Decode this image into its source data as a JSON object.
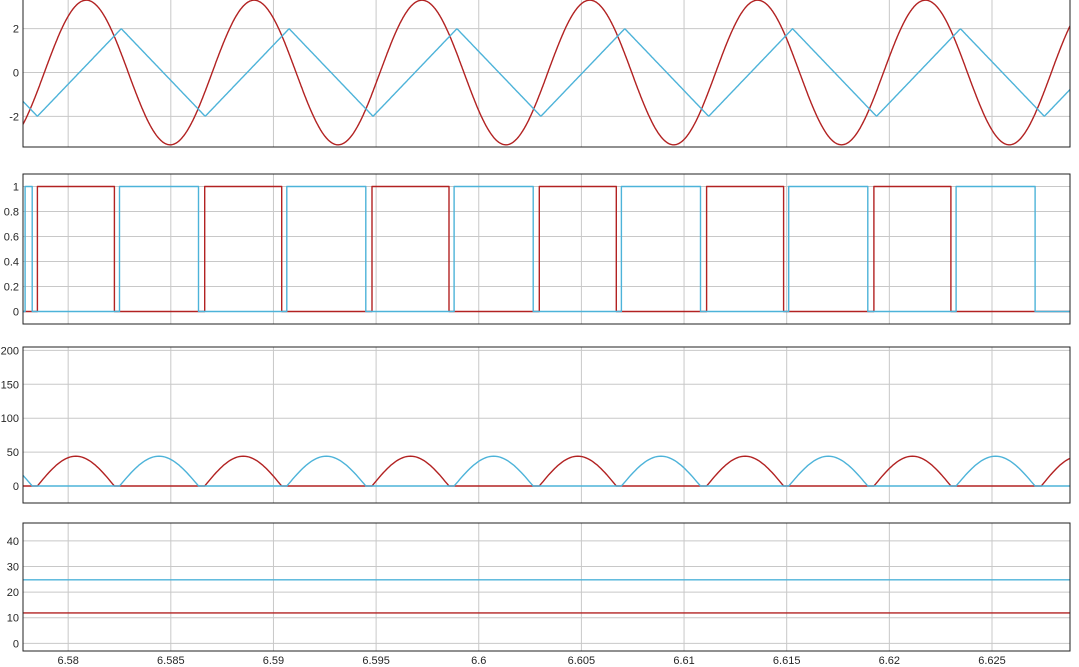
{
  "chart_data": [
    {
      "type": "line",
      "x_range": [
        6.5778,
        6.6288
      ],
      "xlim": [
        6.5778,
        6.6288
      ],
      "x_ticks": [],
      "ylim": [
        -3.4,
        3.4
      ],
      "y_ticks": [
        "-2",
        "0",
        "2"
      ],
      "y_tick_values": [
        -2,
        0,
        2
      ],
      "grid": true,
      "series": [
        {
          "color": "#b22222",
          "shape": "sine",
          "amplitude": 3.3,
          "period": 0.008175,
          "zero_up": 6.57884,
          "note_values": "peak 3.3, trough -3.3"
        },
        {
          "color": "#4db3d9",
          "shape": "triangle",
          "amplitude": 2.0,
          "period": 0.008175,
          "trough_at": 6.5785
        }
      ]
    },
    {
      "type": "line",
      "xlim": [
        6.5778,
        6.6288
      ],
      "ylim": [
        -0.1,
        1.1
      ],
      "y_ticks": [
        "0",
        "0.2",
        "0.4",
        "0.6",
        "0.8",
        "1"
      ],
      "y_tick_values": [
        0,
        0.2,
        0.4,
        0.6,
        0.8,
        1
      ],
      "grid": true,
      "series": [
        {
          "color": "#b22222",
          "shape": "square",
          "high_intervals": [
            [
              6.5785,
              6.58225
            ],
            [
              6.58665,
              6.5904
            ],
            [
              6.5948,
              6.59855
            ],
            [
              6.60295,
              6.6067
            ],
            [
              6.6111,
              6.61485
            ],
            [
              6.61925,
              6.623
            ]
          ]
        },
        {
          "color": "#4db3d9",
          "shape": "square",
          "high_intervals": [
            [
              6.5779,
              6.57825
            ],
            [
              6.5825,
              6.58635
            ],
            [
              6.59065,
              6.5945
            ],
            [
              6.5988,
              6.60265
            ],
            [
              6.60695,
              6.6108
            ],
            [
              6.6151,
              6.61895
            ],
            [
              6.62325,
              6.6271
            ]
          ]
        }
      ]
    },
    {
      "type": "line",
      "xlim": [
        6.5778,
        6.6288
      ],
      "ylim": [
        -25,
        205
      ],
      "y_ticks": [
        "0",
        "50",
        "100",
        "150",
        "200"
      ],
      "y_tick_values": [
        0,
        50,
        100,
        150,
        200
      ],
      "grid": true,
      "series": [
        {
          "color": "#b22222",
          "shape": "half-sine",
          "peak": 44,
          "arcs": [
            [
              6.5785,
              6.58225
            ],
            [
              6.58665,
              6.5904
            ],
            [
              6.5948,
              6.59855
            ],
            [
              6.60295,
              6.6067
            ],
            [
              6.6111,
              6.61485
            ],
            [
              6.61925,
              6.623
            ],
            [
              6.6274,
              6.6311
            ]
          ]
        },
        {
          "color": "#4db3d9",
          "shape": "half-sine",
          "peak": 44,
          "arcs": [
            [
              6.5744,
              6.57825
            ],
            [
              6.5825,
              6.58635
            ],
            [
              6.59065,
              6.5945
            ],
            [
              6.5988,
              6.60265
            ],
            [
              6.60695,
              6.6108
            ],
            [
              6.6151,
              6.61895
            ],
            [
              6.62325,
              6.6271
            ]
          ]
        }
      ]
    },
    {
      "type": "line",
      "xlim": [
        6.5778,
        6.6288
      ],
      "ylim": [
        -3,
        47
      ],
      "y_ticks": [
        "0",
        "10",
        "20",
        "30",
        "40"
      ],
      "y_tick_values": [
        0,
        10,
        20,
        30,
        40
      ],
      "x_ticks": [
        "6.58",
        "6.585",
        "6.59",
        "6.595",
        "6.6",
        "6.605",
        "6.61",
        "6.615",
        "6.62",
        "6.625"
      ],
      "x_tick_values": [
        6.58,
        6.585,
        6.59,
        6.595,
        6.6,
        6.605,
        6.61,
        6.615,
        6.62,
        6.625
      ],
      "grid": true,
      "series": [
        {
          "color": "#4db3d9",
          "shape": "flat",
          "value": 24.8
        },
        {
          "color": "#b22222",
          "shape": "flat",
          "value": 11.9
        }
      ]
    }
  ]
}
